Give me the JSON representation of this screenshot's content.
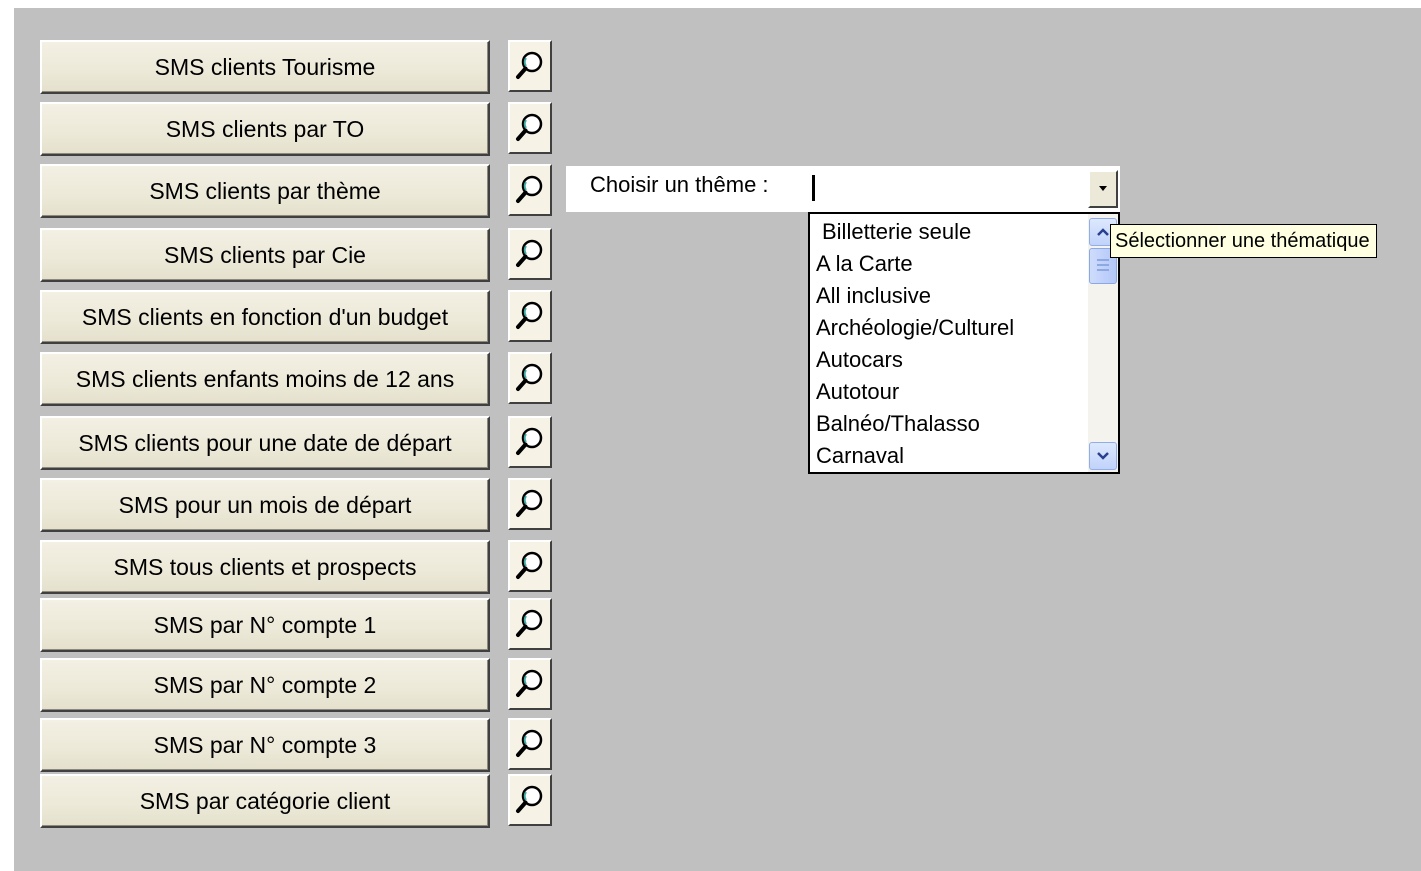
{
  "menu": {
    "buttons": [
      {
        "label": "SMS clients Tourisme"
      },
      {
        "label": "SMS clients par TO"
      },
      {
        "label": "SMS clients par thème"
      },
      {
        "label": "SMS clients par Cie"
      },
      {
        "label": "SMS clients en fonction d'un budget"
      },
      {
        "label": "SMS clients enfants moins de 12 ans"
      },
      {
        "label": "SMS clients pour une date de départ"
      },
      {
        "label": "SMS pour un mois de départ"
      },
      {
        "label": "SMS tous clients et prospects"
      },
      {
        "label": "SMS par N° compte 1"
      },
      {
        "label": "SMS par N° compte 2"
      },
      {
        "label": "SMS par N° compte 3"
      },
      {
        "label": "SMS par catégorie client"
      }
    ],
    "search_icon": "magnifier-icon"
  },
  "theme": {
    "label": "Choisir un thême :",
    "value": "",
    "options": [
      "Billetterie seule",
      "A la Carte",
      "All inclusive",
      "Archéologie/Culturel",
      "Autocars",
      "Autotour",
      "Balnéo/Thalasso",
      "Carnaval"
    ],
    "tooltip": "Sélectionner une thématique"
  },
  "colors": {
    "panel": "#c0c0c0",
    "button_face": "#ece9d8",
    "tooltip_bg": "#ffffe1",
    "scrollbar_accent": "#c1d3fb"
  }
}
